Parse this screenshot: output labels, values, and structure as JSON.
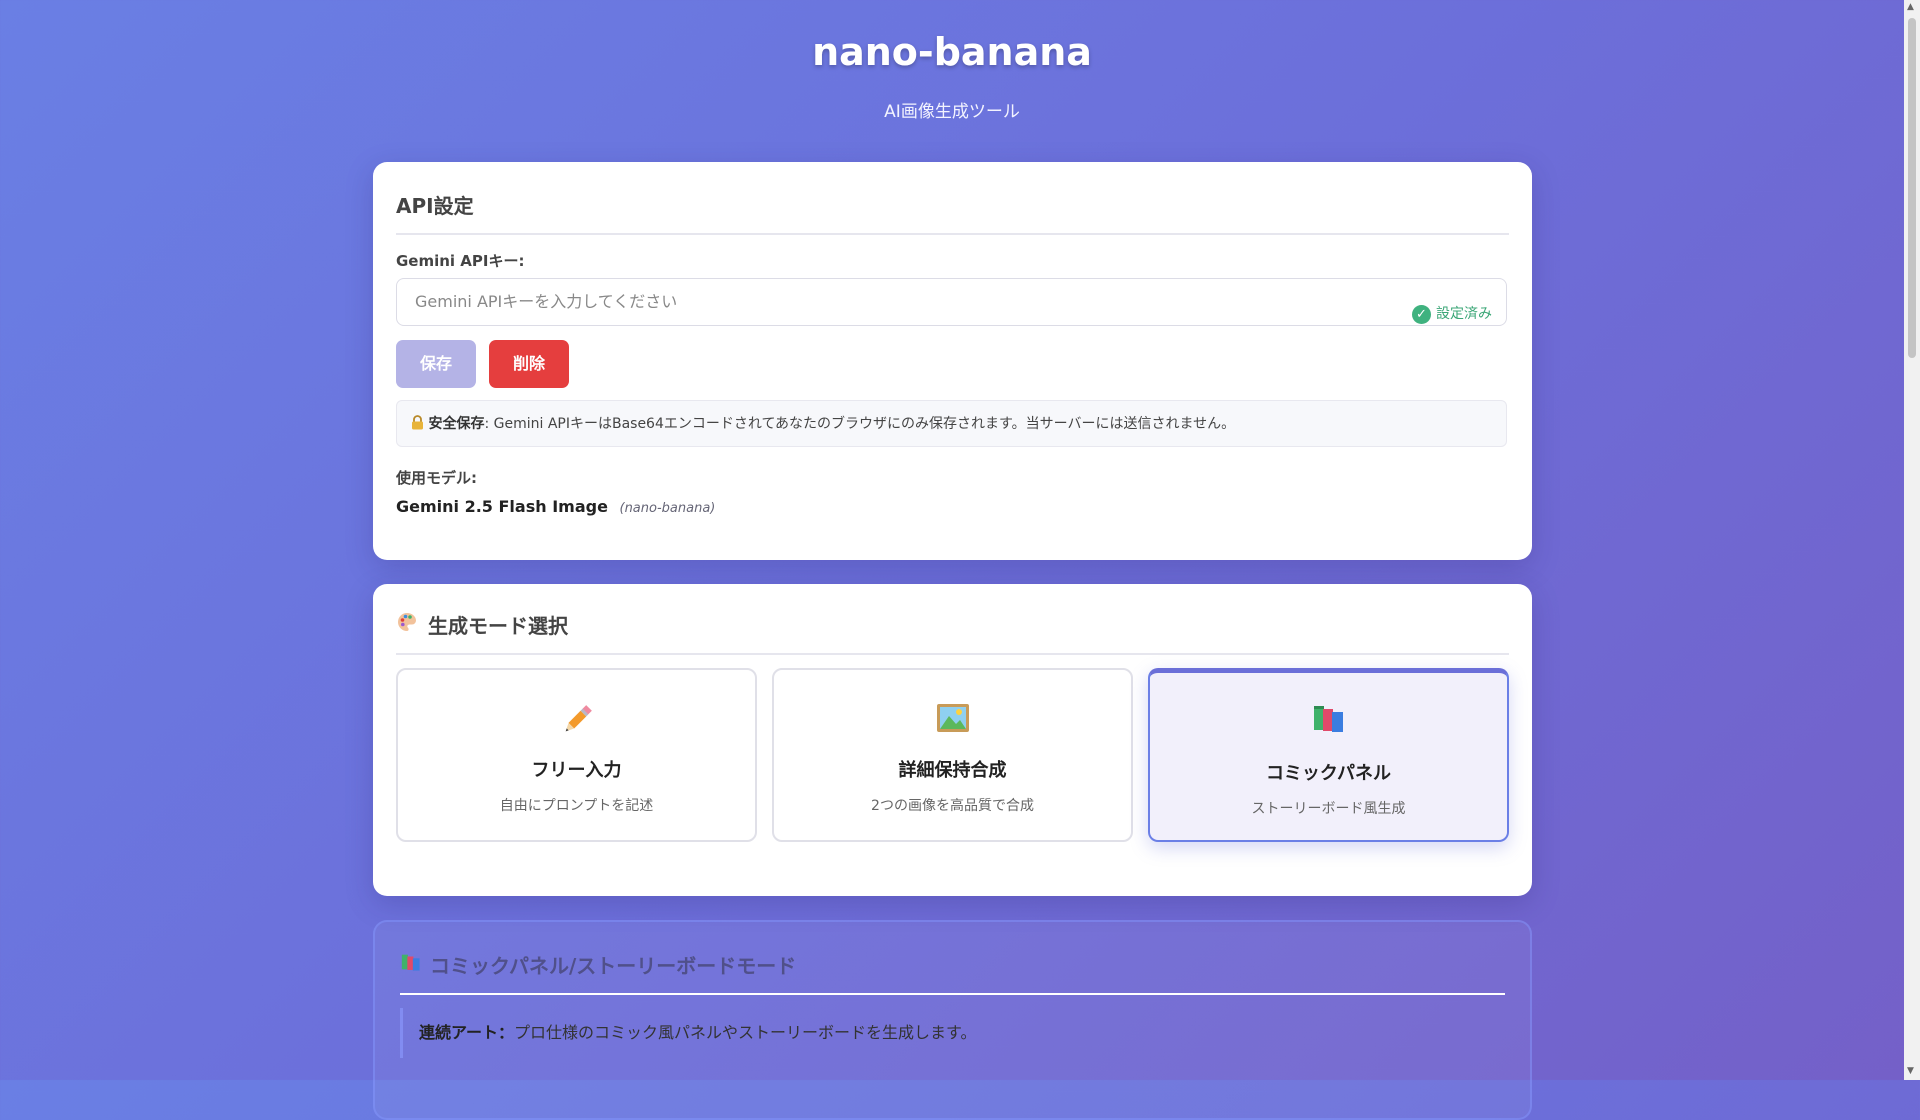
{
  "header": {
    "title": "nano-banana",
    "subtitle": "AI画像生成ツール"
  },
  "api": {
    "section_title": "API設定",
    "key_label": "Gemini APIキー:",
    "key_placeholder": "Gemini APIキーを入力してください",
    "status": "設定済み",
    "save_label": "保存",
    "delete_label": "削除",
    "notice_strong": "安全保存",
    "notice_text": ": Gemini APIキーはBase64エンコードされてあなたのブラウザにのみ保存されます。当サーバーには送信されません。",
    "model_label": "使用モデル:",
    "model_name": "Gemini 2.5 Flash Image",
    "model_code": "(nano-banana)"
  },
  "mode": {
    "section_title": "生成モード選択",
    "tiles": [
      {
        "icon": "pencil-icon",
        "title": "フリー入力",
        "desc": "自由にプロンプトを記述",
        "selected": false
      },
      {
        "icon": "framed-picture-icon",
        "title": "詳細保持合成",
        "desc": "2つの画像を高品質で合成",
        "selected": false
      },
      {
        "icon": "books-icon",
        "title": "コミックパネル",
        "desc": "ストーリーボード風生成",
        "selected": true
      }
    ]
  },
  "comic": {
    "section_title": "コミックパネル/ストーリーボードモード",
    "desc_strong": "連続アート：",
    "desc_text": "プロ仕様のコミック風パネルやストーリーボードを生成します。"
  },
  "colors": {
    "accent": "#6b7fe6",
    "danger": "#e53e3e",
    "success": "#3fb27f"
  }
}
